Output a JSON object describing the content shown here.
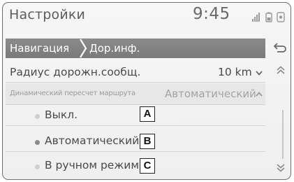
{
  "header": {
    "title": "Настройки",
    "time": "9:45"
  },
  "status_icons": [
    "signal-icon",
    "battery-icon",
    "info-icon"
  ],
  "breadcrumb": {
    "items": [
      "Навигация",
      "Дор.инф."
    ]
  },
  "settings": {
    "radius": {
      "label": "Радиус дорожн.сообщ.",
      "value": "10 km"
    },
    "reroute": {
      "label": "Динамический пересчет маршрута",
      "value": "Автоматический"
    },
    "options": [
      {
        "label": "Выкл.",
        "selected": false,
        "callout": "A"
      },
      {
        "label": "Автоматический",
        "selected": true,
        "callout": "B"
      },
      {
        "label": "В ручном режиме",
        "selected": false,
        "callout": "C"
      }
    ]
  },
  "colors": {
    "breadcrumb_bg": "#808080",
    "screen_bg": "#f2f2f2",
    "text": "#4a4a4a",
    "muted_text": "#a3a3a3"
  }
}
